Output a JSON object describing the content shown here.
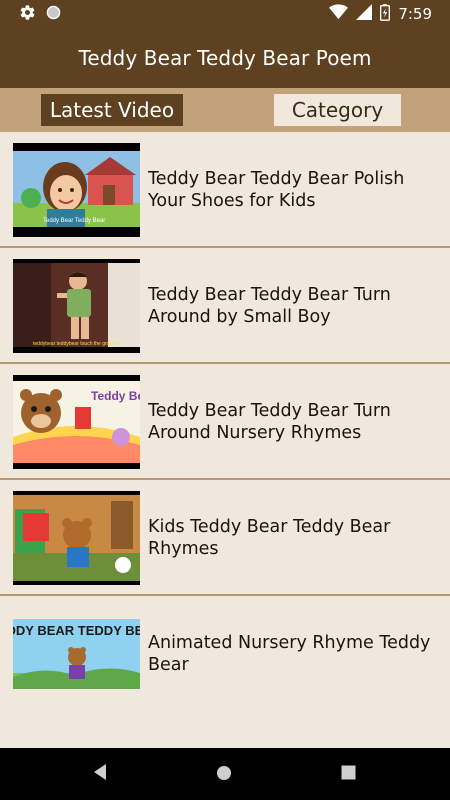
{
  "status_bar": {
    "time": "7:59",
    "icons": [
      "settings-icon",
      "circle-icon",
      "wifi-icon",
      "signal-icon",
      "battery-charging-icon"
    ]
  },
  "app_bar": {
    "title": "Teddy Bear Teddy Bear Poem"
  },
  "tabs": [
    {
      "label": "Latest Video",
      "selected": true
    },
    {
      "label": "Category",
      "selected": false
    }
  ],
  "videos": [
    {
      "title": "Teddy Bear Teddy Bear Polish Your Shoes for Kids",
      "thumb_caption": "Teddy Bear Teddy Bear"
    },
    {
      "title": "Teddy Bear Teddy Bear Turn Around by Small Boy",
      "thumb_caption": "teddybear teddybear touch the ground"
    },
    {
      "title": "Teddy Bear Teddy Bear Turn Around Nursery Rhymes",
      "thumb_caption": "Teddy Bear"
    },
    {
      "title": "Kids Teddy Bear Teddy Bear Rhymes",
      "thumb_caption": ""
    },
    {
      "title": "Animated Nursery Rhyme Teddy Bear",
      "thumb_caption": "TEDDY BEAR TEDDY BEAR"
    }
  ],
  "nav_bar": {
    "icons": [
      "back-icon",
      "home-icon",
      "recents-icon"
    ]
  },
  "colors": {
    "primary": "#5e4121",
    "tab_bar": "#c1a27b",
    "background": "#f0e8dc",
    "divider": "#b89a6f"
  }
}
